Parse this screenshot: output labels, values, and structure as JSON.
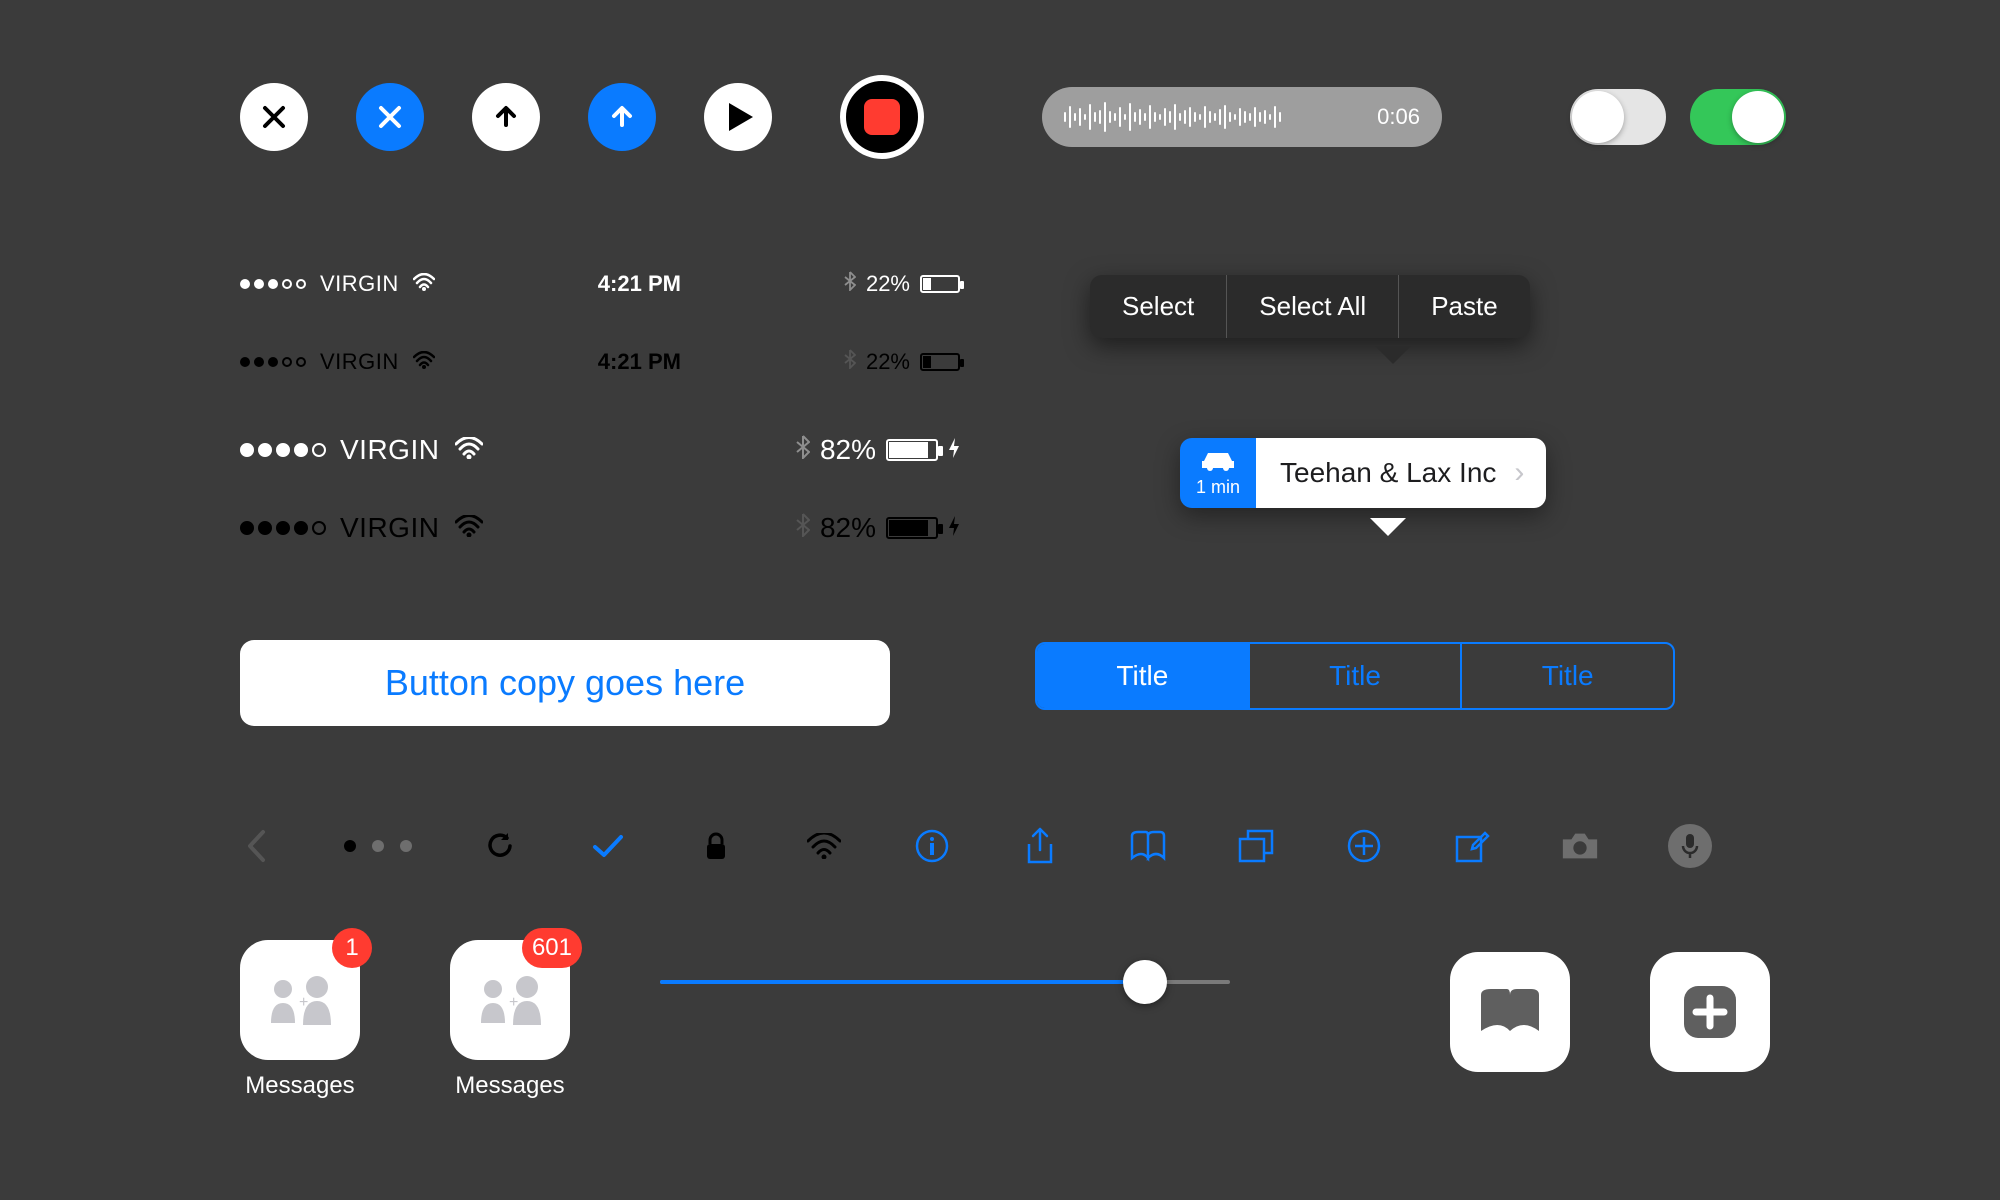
{
  "controls": {
    "audio_time": "0:06"
  },
  "toggles": {
    "switch1": "off",
    "switch2": "on"
  },
  "status_bars": {
    "compact_white": {
      "carrier": "VIRGIN",
      "time": "4:21 PM",
      "battery_pct": "22%",
      "signal_filled": 3,
      "signal_total": 5
    },
    "compact_dark": {
      "carrier": "VIRGIN",
      "time": "4:21 PM",
      "battery_pct": "22%",
      "signal_filled": 3,
      "signal_total": 5
    },
    "large_white": {
      "carrier": "VIRGIN",
      "battery_pct": "82%",
      "signal_filled": 4,
      "signal_total": 5
    },
    "large_dark": {
      "carrier": "VIRGIN",
      "battery_pct": "82%",
      "signal_filled": 4,
      "signal_total": 5
    }
  },
  "text_menu": {
    "select": "Select",
    "select_all": "Select All",
    "paste": "Paste"
  },
  "map_callout": {
    "duration": "1 min",
    "title": "Teehan & Lax Inc"
  },
  "big_button": {
    "label": "Button copy goes here"
  },
  "segmented": {
    "seg1": "Title",
    "seg2": "Title",
    "seg3": "Title"
  },
  "apps": {
    "messages1": {
      "label": "Messages",
      "badge": "1"
    },
    "messages2": {
      "label": "Messages",
      "badge": "601"
    }
  },
  "slider": {
    "value_pct": 85
  },
  "colors": {
    "blue": "#0a7bff",
    "green": "#34c759",
    "red": "#ff3b30",
    "bg": "#3b3b3b"
  }
}
